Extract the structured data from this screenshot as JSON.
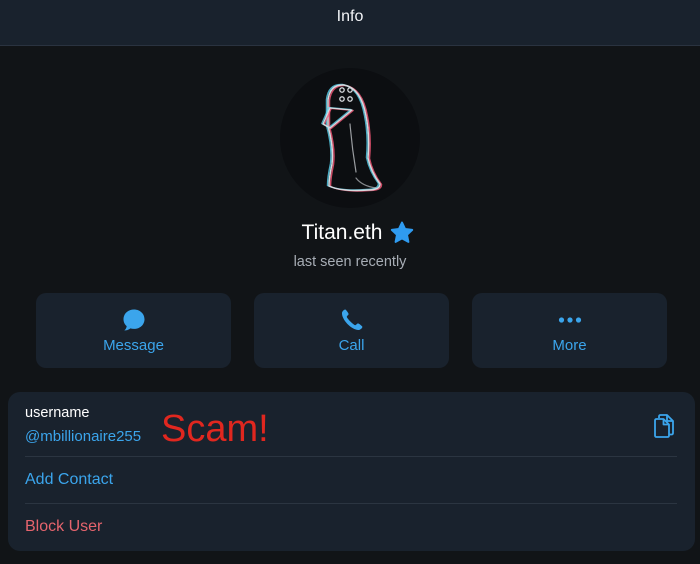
{
  "header": {
    "title": "Info"
  },
  "profile": {
    "name": "Titan.eth",
    "status": "last seen recently",
    "verified_icon": "star-badge-icon",
    "avatar_icon": "penguin-outline-icon"
  },
  "actions": [
    {
      "label": "Message",
      "icon": "chat-bubble-icon"
    },
    {
      "label": "Call",
      "icon": "phone-icon"
    },
    {
      "label": "More",
      "icon": "ellipsis-icon"
    }
  ],
  "info": {
    "username_label": "username",
    "username_value": "@mbillionaire255",
    "annotation": "Scam!",
    "copy_icon": "copy-icon",
    "add_contact": "Add Contact",
    "block_user": "Block User"
  },
  "colors": {
    "background": "#111417",
    "card": "#19222d",
    "accent": "#3ba5ec",
    "danger": "#e5646d",
    "annotation": "#e0271f"
  }
}
